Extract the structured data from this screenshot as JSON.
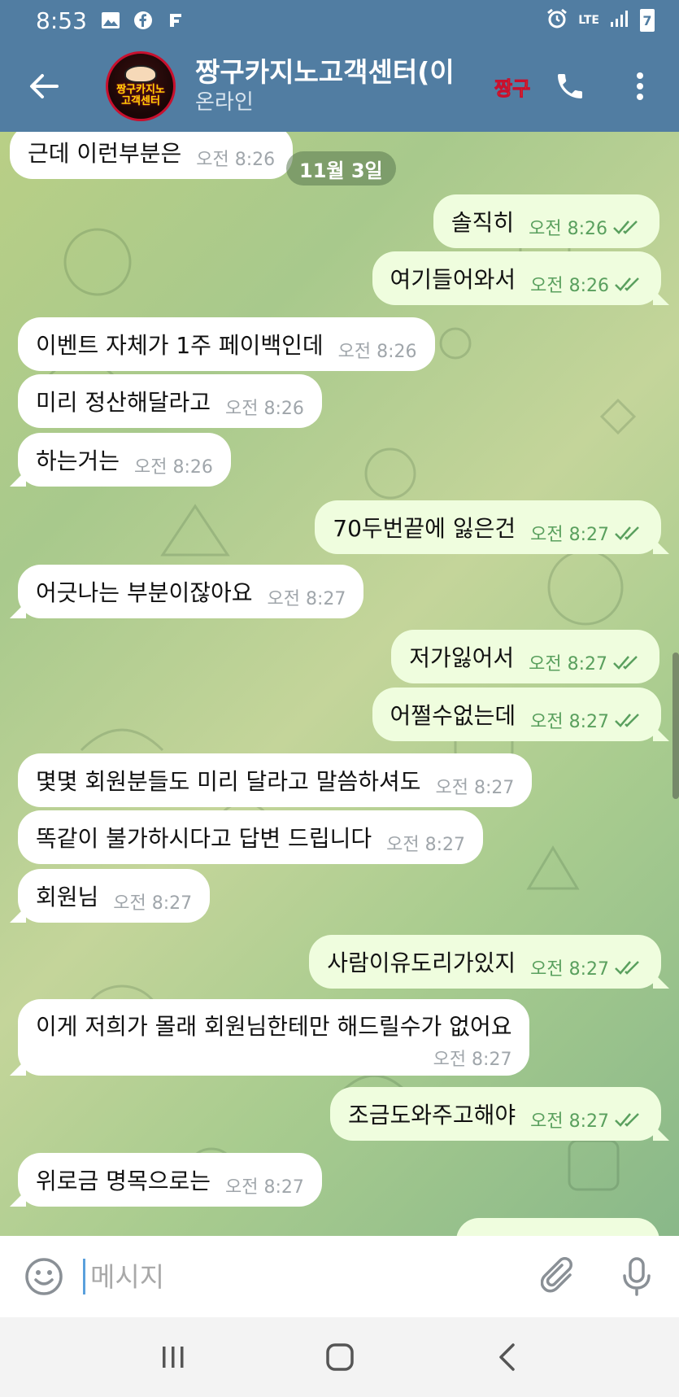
{
  "status_bar": {
    "time": "8:53",
    "network": "LTE",
    "battery": "7",
    "icons": [
      "gallery-icon",
      "facebook-icon",
      "flipboard-icon",
      "alarm-icon",
      "signal-icon",
      "battery-icon"
    ]
  },
  "header": {
    "title": "짱구카지노고객센터(이",
    "status": "온라인",
    "avatar_text_line1": "짱구카지노",
    "avatar_text_line2": "고객센터",
    "sticker_text": "짱구"
  },
  "chat": {
    "date_label": "11월 3일",
    "messages": [
      {
        "side": "in",
        "text": "근데 이런부분은",
        "time": "오전 8:26"
      },
      {
        "side": "out",
        "text": "솔직히",
        "time": "오전 8:26"
      },
      {
        "side": "out",
        "text": "여기들어와서",
        "time": "오전 8:26"
      },
      {
        "side": "in",
        "text": "이벤트 자체가 1주 페이백인데",
        "time": "오전 8:26"
      },
      {
        "side": "in",
        "text": "미리 정산해달라고",
        "time": "오전 8:26"
      },
      {
        "side": "in",
        "text": "하는거는",
        "time": "오전 8:26"
      },
      {
        "side": "out",
        "text": "70두번끝에 잃은건",
        "time": "오전 8:27"
      },
      {
        "side": "in",
        "text": "어긋나는 부분이잖아요",
        "time": "오전 8:27"
      },
      {
        "side": "out",
        "text": "저가잃어서",
        "time": "오전 8:27"
      },
      {
        "side": "out",
        "text": "어쩔수없는데",
        "time": "오전 8:27"
      },
      {
        "side": "in",
        "text": "몇몇 회원분들도 미리 달라고 말씀하셔도",
        "time": "오전 8:27"
      },
      {
        "side": "in",
        "text": "똑같이 불가하시다고 답변 드립니다",
        "time": "오전 8:27"
      },
      {
        "side": "in",
        "text": "회원님",
        "time": "오전 8:27"
      },
      {
        "side": "out",
        "text": "사람이유도리가있지",
        "time": "오전 8:27"
      },
      {
        "side": "in",
        "text": "이게 저희가 몰래 회원님한테만 해드릴수가 없어요",
        "time": "오전 8:27"
      },
      {
        "side": "out",
        "text": "조금도와주고해야",
        "time": "오전 8:27"
      },
      {
        "side": "in",
        "text": "위로금 명목으로는",
        "time": "오전 8:27"
      }
    ]
  },
  "input": {
    "placeholder": "메시지"
  },
  "navbar": {
    "buttons": [
      "recent-apps",
      "home",
      "back"
    ]
  }
}
